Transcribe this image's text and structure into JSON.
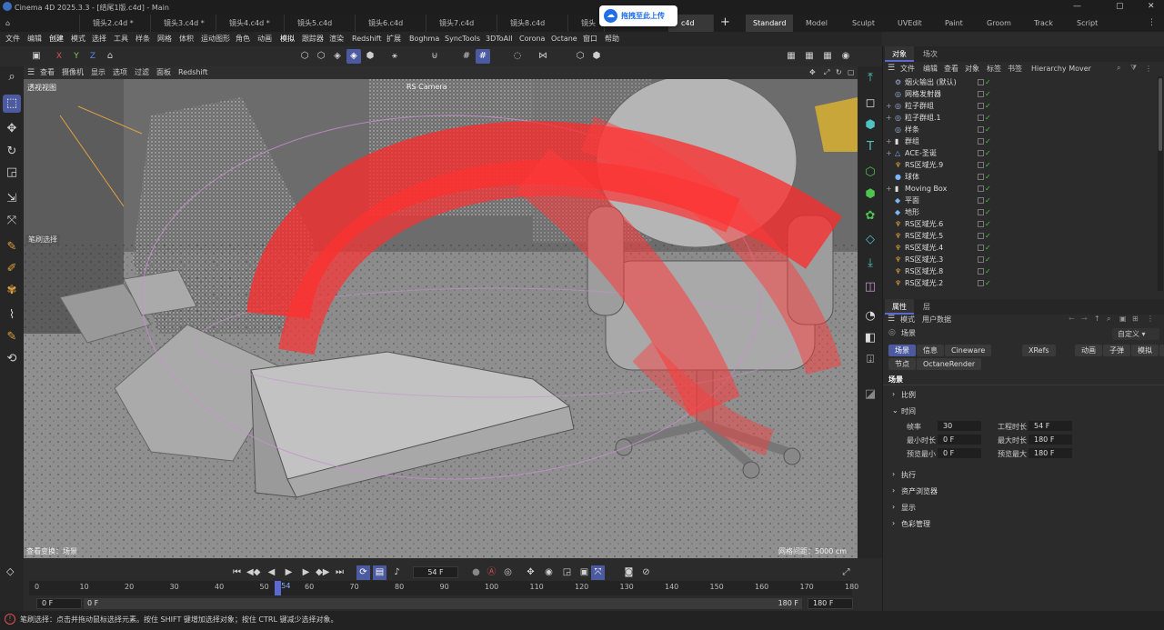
{
  "app": {
    "title": "Cinema 4D 2025.3.3 - [结尾1版.c4d] - Main",
    "window_buttons": [
      "—",
      "▢",
      "✕"
    ]
  },
  "doc_tabs": [
    "镜头2.c4d *",
    "镜头3.c4d *",
    "镜头4.c4d *",
    "镜头5.c4d",
    "镜头6.c4d",
    "镜头7.c4d",
    "镜头8.c4d",
    "镜头9.c4d",
    "c4d"
  ],
  "layouts": [
    "Standard",
    "Model",
    "Sculpt",
    "UVEdit",
    "Paint",
    "Groom",
    "Track",
    "Script"
  ],
  "upload_badge": "拖拽至此上传",
  "menus": [
    "文件",
    "编辑",
    "创建",
    "模式",
    "选择",
    "工具",
    "样条",
    "网格",
    "体积",
    "运动图形",
    "角色",
    "动画",
    "模拟",
    "跟踪器",
    "渲染",
    "Redshift",
    "扩展",
    "Boghma",
    "SyncTools",
    "3DToAll",
    "Corona",
    "Octane",
    "窗口",
    "帮助"
  ],
  "axis": {
    "x": "X",
    "y": "Y",
    "z": "Z",
    "x_color": "#e05050",
    "y_color": "#8ac84a",
    "z_color": "#5a8ae0"
  },
  "viewport_menu": [
    "查看",
    "摄像机",
    "显示",
    "选项",
    "过滤",
    "面板",
    "Redshift"
  ],
  "viewport": {
    "name": "透视视图",
    "camera": "RS Camera",
    "brush_label": "笔刷选择",
    "bottom_left": "查看变换：场景",
    "grid_spacing": "网格间距：5000 cm"
  },
  "timeline": {
    "current_frame": "54 F",
    "ticks": [
      "0",
      "10",
      "20",
      "30",
      "40",
      "50",
      "60",
      "70",
      "80",
      "90",
      "100",
      "110",
      "120",
      "130",
      "140",
      "150",
      "160",
      "170",
      "180"
    ],
    "start": "0 F",
    "min": "0 F",
    "end": "180 F",
    "max": "180 F",
    "playhead_label": "54",
    "playhead_frame": 54
  },
  "status": "笔刷选择：点击并拖动鼠标选择元素。按住 SHIFT 键增加选择对象；按住 CTRL 键减少选择对象。",
  "object_manager": {
    "tabs": [
      "对象",
      "场次"
    ],
    "menu": [
      "文件",
      "编辑",
      "查看",
      "对象",
      "标签",
      "书签"
    ],
    "plugin": "Hierarchy Mover",
    "objects": [
      {
        "name": "烟火输出 (默认)",
        "icon": "⚙",
        "color": "#9ab0e0",
        "expand": ""
      },
      {
        "name": "网格发射器",
        "icon": "◎",
        "color": "#9ab0e0",
        "expand": ""
      },
      {
        "name": "粒子群组",
        "icon": "◎",
        "color": "#9ab0e0",
        "expand": "+"
      },
      {
        "name": "粒子群组.1",
        "icon": "◎",
        "color": "#9ab0e0",
        "expand": "+"
      },
      {
        "name": "样条",
        "icon": "◎",
        "color": "#9ab0e0",
        "expand": ""
      },
      {
        "name": "群组",
        "icon": "▮",
        "color": "#e0e0e0",
        "expand": "+"
      },
      {
        "name": "ACE-圣诞",
        "icon": "△",
        "color": "#7ab8ff",
        "expand": "+"
      },
      {
        "name": "RS区域光.9",
        "icon": "♆",
        "color": "#e0a040",
        "expand": ""
      },
      {
        "name": "球体",
        "icon": "●",
        "color": "#7ab8ff",
        "expand": ""
      },
      {
        "name": "Moving Box",
        "icon": "▮",
        "color": "#e0e0e0",
        "expand": "+"
      },
      {
        "name": "平面",
        "icon": "◆",
        "color": "#7ab8ff",
        "expand": ""
      },
      {
        "name": "地形",
        "icon": "◆",
        "color": "#7ab8ff",
        "expand": ""
      },
      {
        "name": "RS区域光.6",
        "icon": "♆",
        "color": "#e0a040",
        "expand": ""
      },
      {
        "name": "RS区域光.5",
        "icon": "♆",
        "color": "#e0a040",
        "expand": ""
      },
      {
        "name": "RS区域光.4",
        "icon": "♆",
        "color": "#e0a040",
        "expand": ""
      },
      {
        "name": "RS区域光.3",
        "icon": "♆",
        "color": "#e0a040",
        "expand": ""
      },
      {
        "name": "RS区域光.8",
        "icon": "♆",
        "color": "#e0a040",
        "expand": ""
      },
      {
        "name": "RS区域光.2",
        "icon": "♆",
        "color": "#e0a040",
        "expand": ""
      }
    ]
  },
  "attributes": {
    "tabs": [
      "属性",
      "层"
    ],
    "menu": [
      "模式",
      "用户数据"
    ],
    "object_name": "场景",
    "preset": "自定义",
    "pill_tabs_row1": [
      "场景",
      "信息",
      "Cineware",
      "XRefs",
      "动画",
      "子弹",
      "模拟",
      "待办事项"
    ],
    "pill_tabs_row2": [
      "节点",
      "OctaneRender"
    ],
    "section_title": "场景",
    "groups": [
      "比例",
      "时间",
      "执行",
      "资产浏览器",
      "显示",
      "色彩管理"
    ],
    "fields": [
      {
        "label": "帧率",
        "value": "30"
      },
      {
        "label": "工程时长",
        "value": "54 F"
      },
      {
        "label": "最小时长",
        "value": "0 F"
      },
      {
        "label": "最大时长",
        "value": "180 F"
      },
      {
        "label": "预览最小",
        "value": "0 F"
      },
      {
        "label": "预览最大",
        "value": "180 F"
      }
    ]
  }
}
